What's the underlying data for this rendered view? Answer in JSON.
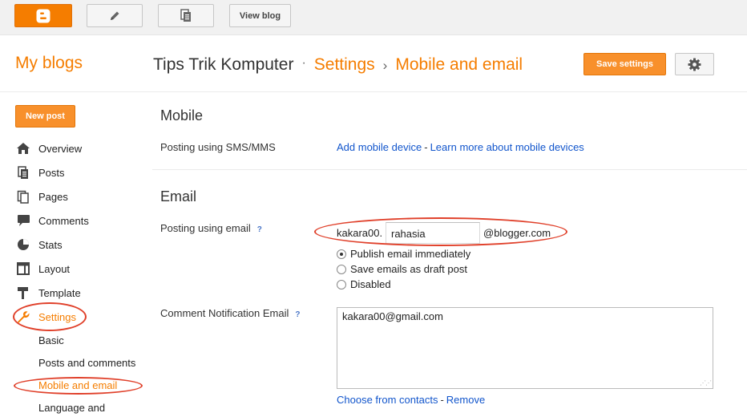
{
  "topbar": {
    "view_blog": "View blog"
  },
  "header": {
    "my_blogs": "My blogs",
    "blog_name": "Tips Trik Komputer",
    "dot": "·",
    "crumb_settings": "Settings",
    "crumb_sep": "›",
    "crumb_page": "Mobile and email",
    "save_label": "Save settings"
  },
  "sidebar": {
    "new_post": "New post",
    "items": [
      {
        "label": "Overview",
        "icon": "home-icon"
      },
      {
        "label": "Posts",
        "icon": "posts-icon"
      },
      {
        "label": "Pages",
        "icon": "pages-icon"
      },
      {
        "label": "Comments",
        "icon": "comments-icon"
      },
      {
        "label": "Stats",
        "icon": "stats-icon"
      },
      {
        "label": "Layout",
        "icon": "layout-icon"
      },
      {
        "label": "Template",
        "icon": "template-icon"
      },
      {
        "label": "Settings",
        "icon": "wrench-icon"
      }
    ],
    "sub_items": [
      {
        "label": "Basic"
      },
      {
        "label": "Posts and comments"
      },
      {
        "label": "Mobile and email"
      },
      {
        "label": "Language and"
      }
    ]
  },
  "mobile": {
    "heading": "Mobile",
    "sms_label": "Posting using SMS/MMS",
    "add_device": "Add mobile device",
    "dash": "-",
    "learn_more": "Learn more about mobile devices"
  },
  "email": {
    "heading": "Email",
    "posting_label": "Posting using email",
    "help": "?",
    "prefix": "kakara00.",
    "secret": "rahasia",
    "suffix": "@blogger.com",
    "options": [
      {
        "label": "Publish email immediately",
        "checked": true
      },
      {
        "label": "Save emails as draft post",
        "checked": false
      },
      {
        "label": "Disabled",
        "checked": false
      }
    ],
    "notify_label": "Comment Notification Email",
    "notify_value": "kakara00@gmail.com",
    "choose_contacts": "Choose from contacts",
    "remove": "Remove"
  },
  "colors": {
    "accent": "#f57d00",
    "link": "#1155cc",
    "annotation": "#e0402a"
  }
}
